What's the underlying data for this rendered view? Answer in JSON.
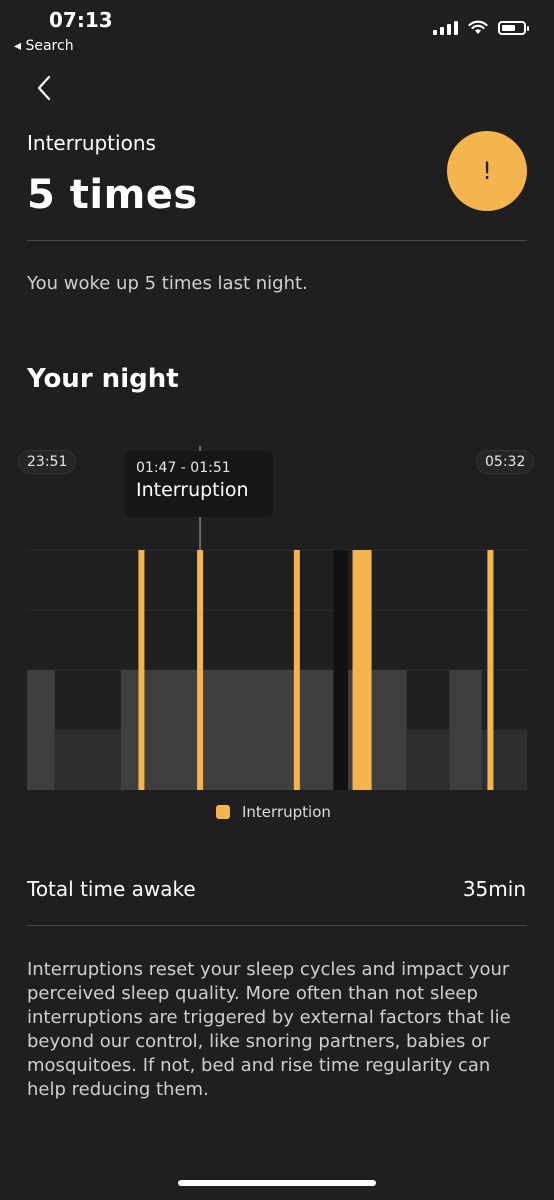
{
  "status_bar": {
    "time": "07:13",
    "back_app": "◂ Search",
    "icons": [
      "signal-icon",
      "wifi-icon",
      "battery-icon"
    ]
  },
  "header": {
    "label": "Interruptions",
    "value": "5 times",
    "alert_symbol": "!",
    "alert_color": "#f4b54f"
  },
  "summary": "You woke up 5 times last night.",
  "night": {
    "title": "Your night",
    "start_time": "23:51",
    "end_time": "05:32",
    "tooltip": {
      "time_range": "01:47 - 01:51",
      "label": "Interruption"
    },
    "legend": [
      {
        "label": "Interruption",
        "color": "#f4b54f"
      }
    ]
  },
  "chart_data": {
    "type": "bar",
    "x_range": [
      "23:51",
      "05:32"
    ],
    "series": [
      {
        "name": "Interruption",
        "color": "#f4b54f",
        "events": [
          {
            "start": "01:07",
            "end": "01:09"
          },
          {
            "start": "01:47",
            "end": "01:51"
          },
          {
            "start": "02:53",
            "end": "02:56"
          },
          {
            "start": "03:33",
            "end": "03:46"
          },
          {
            "start": "05:05",
            "end": "05:07"
          }
        ]
      }
    ],
    "sleep_phases": [
      {
        "start": "23:51",
        "end": "00:10",
        "level": 2
      },
      {
        "start": "00:10",
        "end": "00:55",
        "level": 1
      },
      {
        "start": "00:55",
        "end": "03:20",
        "level": 2
      },
      {
        "start": "03:20",
        "end": "03:30",
        "level": 4
      },
      {
        "start": "03:30",
        "end": "04:10",
        "level": 2
      },
      {
        "start": "04:10",
        "end": "04:39",
        "level": 1
      },
      {
        "start": "04:39",
        "end": "05:01",
        "level": 2
      },
      {
        "start": "05:01",
        "end": "05:32",
        "level": 1
      }
    ],
    "selected_event_index": 1
  },
  "totals": {
    "label": "Total time awake",
    "value": "35min"
  },
  "info": "Interruptions reset your sleep cycles and impact your perceived sleep quality. More often than not sleep interruptions are triggered by external factors that lie beyond our control, like snoring partners, babies or mosquitoes. If not, bed and rise time regularity can help reducing them."
}
